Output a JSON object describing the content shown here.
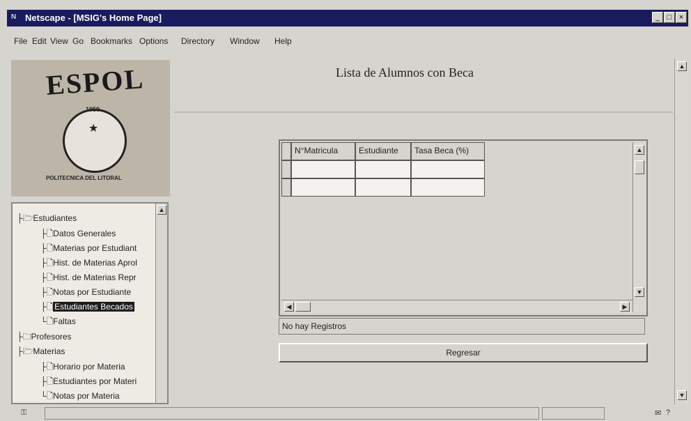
{
  "window": {
    "title": "Netscape - [MSIG's Home Page]",
    "logo_glyph": "N",
    "controls": [
      "_",
      "□",
      "×"
    ]
  },
  "menu": [
    "File",
    "Edit",
    "View",
    "Go",
    "Bookmarks",
    "Options",
    "Directory",
    "Window",
    "Help"
  ],
  "logo": {
    "title": "ESPOL",
    "year": "1959",
    "bottom_text": "POLITECNICA DEL LITORAL"
  },
  "tree": {
    "items": [
      {
        "label": "Estudiantes",
        "selected": false
      },
      {
        "label": "Datos Generales",
        "selected": false
      },
      {
        "label": "Materias por Estudiant",
        "selected": false
      },
      {
        "label": "Hist. de Materias Aprol",
        "selected": false
      },
      {
        "label": "Hist. de Materias Repr",
        "selected": false
      },
      {
        "label": "Notas por Estudiante",
        "selected": false
      },
      {
        "label": "Estudiantes Becados",
        "selected": true
      },
      {
        "label": "Faltas",
        "selected": false
      },
      {
        "label": "Profesores",
        "selected": false
      },
      {
        "label": "Materias",
        "selected": false
      },
      {
        "label": "Horario por Materia",
        "selected": false
      },
      {
        "label": "Estudiantes por Materi",
        "selected": false
      },
      {
        "label": "Notas por Materia",
        "selected": false
      }
    ]
  },
  "main": {
    "title": "Lista de Alumnos con Beca",
    "table": {
      "headers": [
        "N°Matricula",
        "Estudiante",
        "Tasa Beca (%)"
      ],
      "rows": [
        [
          "",
          "",
          ""
        ],
        [
          "",
          "",
          ""
        ]
      ]
    },
    "status_text": "No hay Registros",
    "back_label": "Regresar"
  },
  "statusbar": {
    "left_icon": "security-key-icon",
    "right_icon": "mail-icon",
    "right_text": "?"
  },
  "colors": {
    "titlebar": "#181c5e",
    "selected": "#1b1b1b"
  }
}
